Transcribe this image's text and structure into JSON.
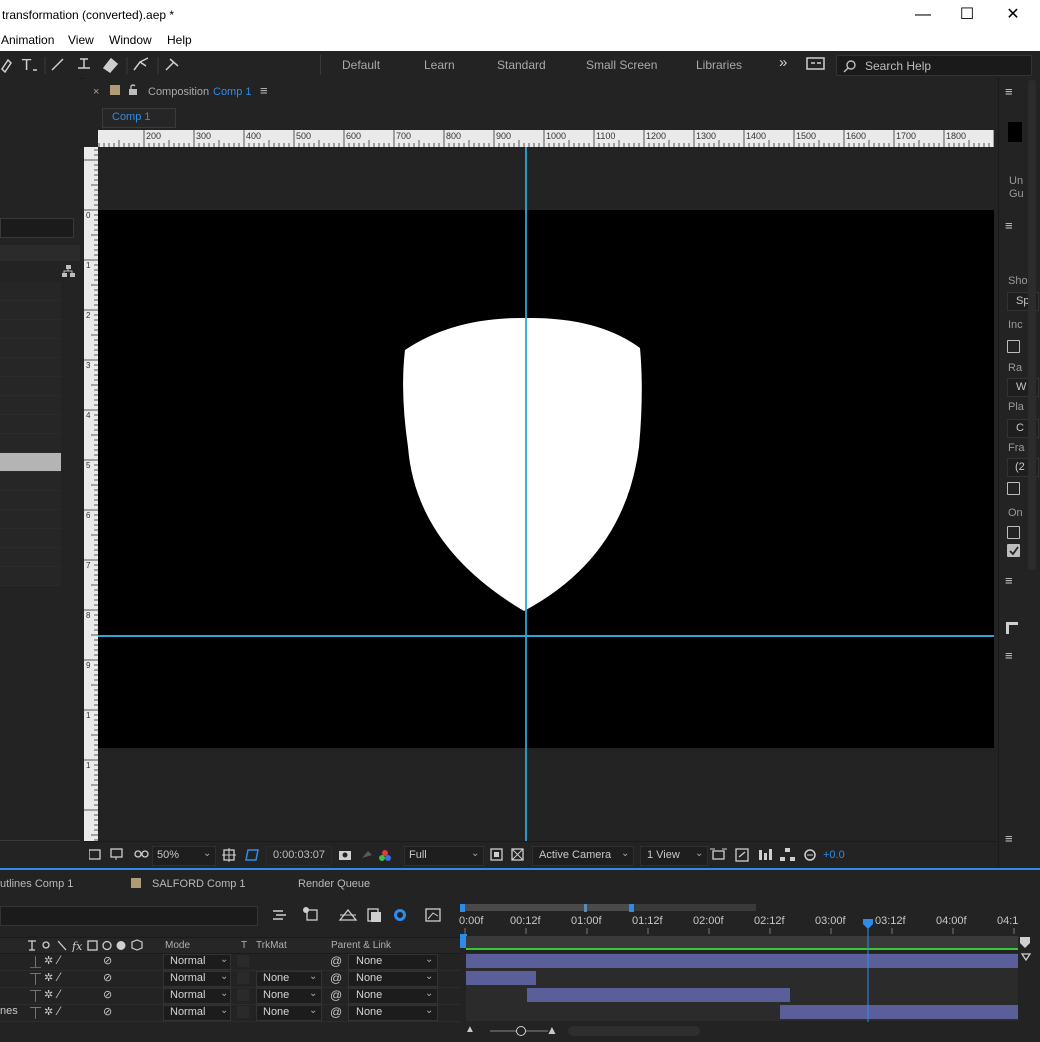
{
  "window": {
    "title": "transformation (converted).aep *",
    "minimize": "—",
    "maximize": "☐",
    "close": "✕"
  },
  "menu": [
    "Animation",
    "View",
    "Window",
    "Help"
  ],
  "workspaces": [
    "Default",
    "Learn",
    "Standard",
    "Small Screen",
    "Libraries"
  ],
  "workspace_more": "»",
  "search": {
    "placeholder": "Search Help"
  },
  "composition": {
    "panel_label": "Composition",
    "name": "Comp 1",
    "tab": "Comp 1"
  },
  "ruler": {
    "top_labels": [
      "200",
      "300",
      "400",
      "500",
      "600",
      "700",
      "800",
      "900",
      "1000",
      "1100",
      "1200",
      "1300",
      "1400",
      "1500",
      "1600",
      "1700",
      "1800"
    ],
    "left_labels": [
      "0",
      "1",
      "2",
      "3",
      "4",
      "5",
      "6",
      "7",
      "8",
      "9",
      "1",
      "1"
    ]
  },
  "footer": {
    "zoom": "50%",
    "timecode": "0:00:03:07",
    "resolution": "Full",
    "camera": "Active Camera",
    "view": "1 View",
    "exposure": "+0.0"
  },
  "right_panel": {
    "labels": [
      "Un",
      "Gu",
      "Sho",
      "Sp",
      "Inc",
      "Ra",
      "W",
      "Pla",
      "C",
      "Fra",
      "(2",
      "On"
    ]
  },
  "timeline": {
    "tabs": [
      "utlines Comp 1",
      "SALFORD Comp 1",
      "Render Queue"
    ],
    "time_labels": [
      "0:00f",
      "00:12f",
      "01:00f",
      "01:12f",
      "02:00f",
      "02:12f",
      "03:00f",
      "03:12f",
      "04:00f",
      "04:1"
    ],
    "columns": {
      "mode": "Mode",
      "t": "T",
      "trkmat": "TrkMat",
      "parent": "Parent & Link"
    },
    "layers": [
      {
        "name": "",
        "mode": "Normal",
        "trkmat": "",
        "parent": "None"
      },
      {
        "name": "",
        "mode": "Normal",
        "trkmat": "None",
        "parent": "None"
      },
      {
        "name": "",
        "mode": "Normal",
        "trkmat": "None",
        "parent": "None"
      },
      {
        "name": "nes",
        "mode": "Normal",
        "trkmat": "None",
        "parent": "None"
      }
    ]
  },
  "colors": {
    "accent": "#2d8ceb",
    "guide": "#2aa6d6",
    "layer_bar": "#5a5f9a",
    "work_area": "#33cc33"
  }
}
